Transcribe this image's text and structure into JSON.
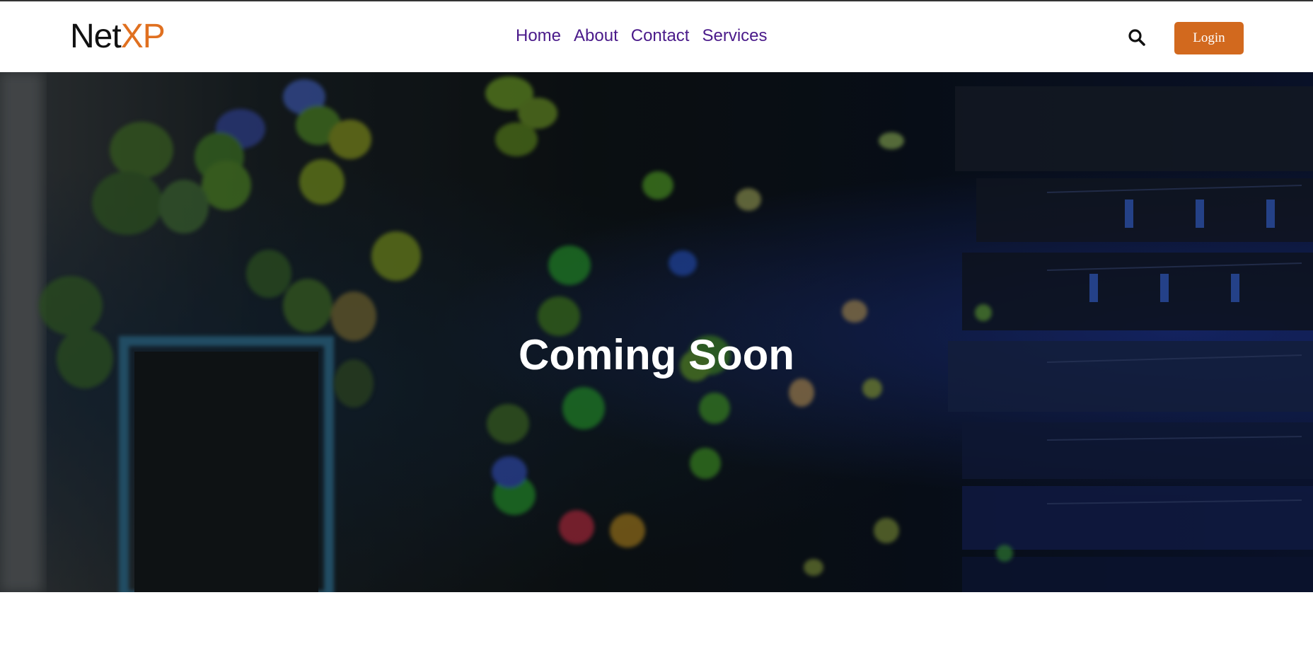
{
  "brand": {
    "name_part1": "Net",
    "name_part2": "XP",
    "accent_color": "#e07020"
  },
  "nav": {
    "items": [
      {
        "label": "Home"
      },
      {
        "label": "About"
      },
      {
        "label": "Contact"
      },
      {
        "label": "Services"
      }
    ],
    "link_color": "#4a1a8a"
  },
  "header": {
    "search_icon": "search-icon",
    "login_label": "Login",
    "login_color": "#d2691e"
  },
  "hero": {
    "title": "Coming Soon"
  }
}
